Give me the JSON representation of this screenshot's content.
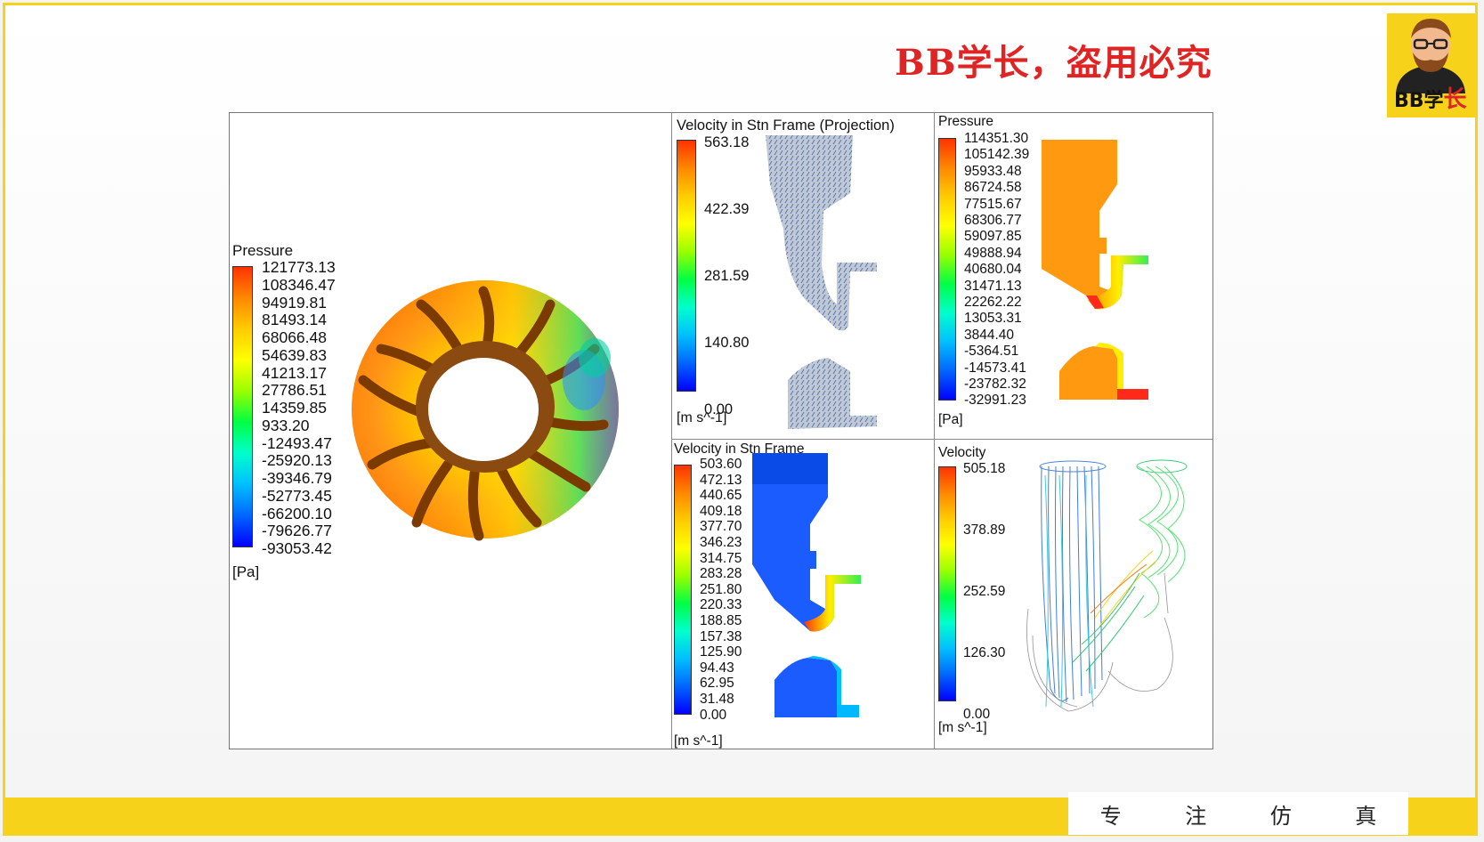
{
  "header": {
    "title": "BB学长，盗用必究"
  },
  "logo": {
    "text_a": "BB学",
    "text_b": "长"
  },
  "footer": {
    "slogan": [
      "专",
      "注",
      "仿",
      "真"
    ]
  },
  "colormap": [
    "#0000ff",
    "#0066ff",
    "#00bfff",
    "#00ffcc",
    "#00ff44",
    "#99ff00",
    "#ffff00",
    "#ffcc00",
    "#ff8800",
    "#ff3300"
  ],
  "panels": {
    "pressure_main": {
      "title": "Pressure",
      "unit": "[Pa]",
      "ticks": [
        "121773.13",
        "108346.47",
        "94919.81",
        "81493.14",
        "68066.48",
        "54639.83",
        "41213.17",
        "27786.51",
        "14359.85",
        "933.20",
        "-12493.47",
        "-25920.13",
        "-39346.79",
        "-52773.45",
        "-66200.10",
        "-79626.77",
        "-93053.42"
      ]
    },
    "velocity_projection": {
      "title": "Velocity in Stn Frame (Projection)",
      "unit": "[m s^-1]",
      "ticks": [
        "563.18",
        "422.39",
        "281.59",
        "140.80",
        "0.00"
      ]
    },
    "pressure_section": {
      "title": "Pressure",
      "unit": "[Pa]",
      "ticks": [
        "114351.30",
        "105142.39",
        "95933.48",
        "86724.58",
        "77515.67",
        "68306.77",
        "59097.85",
        "49888.94",
        "40680.04",
        "31471.13",
        "22262.22",
        "13053.31",
        "3844.40",
        "-5364.51",
        "-14573.41",
        "-23782.32",
        "-32991.23"
      ]
    },
    "velocity_stn": {
      "title": "Velocity in Stn Frame",
      "unit": "[m s^-1]",
      "ticks": [
        "503.60",
        "472.13",
        "440.65",
        "409.18",
        "377.70",
        "346.23",
        "314.75",
        "283.28",
        "251.80",
        "220.33",
        "188.85",
        "157.38",
        "125.90",
        "94.43",
        "62.95",
        "31.48",
        "0.00"
      ]
    },
    "velocity_streamlines": {
      "title": "Velocity",
      "unit": "[m s^-1]",
      "ticks": [
        "505.18",
        "378.89",
        "252.59",
        "126.30",
        "0.00"
      ]
    }
  }
}
